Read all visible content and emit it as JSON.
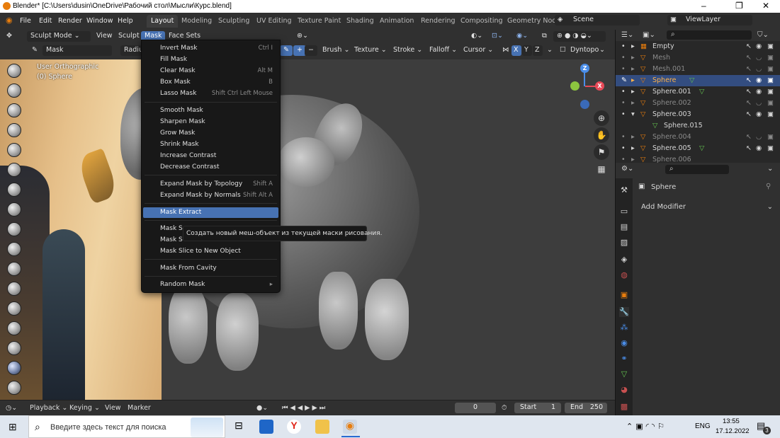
{
  "window": {
    "title": "Blender* [C:\\Users\\dusin\\OneDrive\\Рабочий стол\\Мысли\\Курс.blend]",
    "controls": [
      "–",
      "❐",
      "✕"
    ]
  },
  "menubar": {
    "items": [
      "File",
      "Edit",
      "Render",
      "Window",
      "Help"
    ],
    "workspaces": [
      "Layout",
      "Modeling",
      "Sculpting",
      "UV Editing",
      "Texture Paint",
      "Shading",
      "Animation",
      "Rendering",
      "Compositing",
      "Geometry Noc"
    ],
    "active_workspace": "Layout",
    "scene_label": "Scene",
    "viewlayer_label": "ViewLayer"
  },
  "header": {
    "mode": "Sculpt Mode",
    "menus": [
      "View",
      "Sculpt",
      "Mask",
      "Face Sets"
    ],
    "tool_name": "Mask",
    "radius_label": "Radiu",
    "plus": "+",
    "minus": "−",
    "dropdowns": [
      "Brush",
      "Texture",
      "Stroke",
      "Falloff",
      "Cursor"
    ],
    "axes": [
      "X",
      "Y",
      "Z"
    ],
    "dyntopo": "Dyntopo"
  },
  "viewport": {
    "view_name": "User Orthographic",
    "object_name": "(0) Sphere",
    "gizmo": {
      "z": "Z",
      "x": "X",
      "y": "Y"
    }
  },
  "mask_menu": {
    "groups": [
      [
        {
          "label": "Invert Mask",
          "shortcut": "Ctrl I"
        },
        {
          "label": "Fill Mask",
          "shortcut": ""
        },
        {
          "label": "Clear Mask",
          "shortcut": "Alt M"
        },
        {
          "label": "Box Mask",
          "shortcut": "B"
        },
        {
          "label": "Lasso Mask",
          "shortcut": "Shift Ctrl Left Mouse"
        }
      ],
      [
        {
          "label": "Smooth Mask",
          "shortcut": ""
        },
        {
          "label": "Sharpen Mask",
          "shortcut": ""
        },
        {
          "label": "Grow Mask",
          "shortcut": ""
        },
        {
          "label": "Shrink Mask",
          "shortcut": ""
        },
        {
          "label": "Increase Contrast",
          "shortcut": ""
        },
        {
          "label": "Decrease Contrast",
          "shortcut": ""
        }
      ],
      [
        {
          "label": "Expand Mask by Topology",
          "shortcut": "Shift A"
        },
        {
          "label": "Expand Mask by Normals",
          "shortcut": "Shift Alt A"
        }
      ],
      [
        {
          "label": "Mask Extract",
          "shortcut": "",
          "highlighted": true
        }
      ],
      [
        {
          "label": "Mask S",
          "shortcut": ""
        },
        {
          "label": "Mask S",
          "shortcut": ""
        },
        {
          "label": "Mask Slice to New Object",
          "shortcut": ""
        }
      ],
      [
        {
          "label": "Mask From Cavity",
          "shortcut": ""
        }
      ],
      [
        {
          "label": "Random Mask",
          "shortcut": "▸"
        }
      ]
    ],
    "tooltip": "Создать новый меш-объект из текущей маски рисования."
  },
  "timeline": {
    "playback": "Playback",
    "keying": "Keying",
    "view": "View",
    "marker": "Marker",
    "current_frame": "0",
    "start_label": "Start",
    "start": "1",
    "end_label": "End",
    "end": "250"
  },
  "outliner": {
    "rows": [
      {
        "name": "Empty",
        "dim": false,
        "selected": false,
        "child": false
      },
      {
        "name": "Mesh",
        "dim": true,
        "selected": false,
        "child": false
      },
      {
        "name": "Mesh.001",
        "dim": true,
        "selected": false,
        "child": false
      },
      {
        "name": "Sphere",
        "dim": false,
        "selected": true,
        "child": false
      },
      {
        "name": "Sphere.001",
        "dim": false,
        "selected": false,
        "child": false
      },
      {
        "name": "Sphere.002",
        "dim": true,
        "selected": false,
        "child": false
      },
      {
        "name": "Sphere.003",
        "dim": false,
        "selected": false,
        "child": false
      },
      {
        "name": "Sphere.015",
        "dim": false,
        "selected": false,
        "child": true
      },
      {
        "name": "Sphere.004",
        "dim": true,
        "selected": false,
        "child": false
      },
      {
        "name": "Sphere.005",
        "dim": false,
        "selected": false,
        "child": false
      },
      {
        "name": "Sphere.006",
        "dim": true,
        "selected": false,
        "child": false
      }
    ]
  },
  "properties": {
    "object_name": "Sphere",
    "add_modifier": "Add Modifier"
  },
  "taskbar": {
    "search_placeholder": "Введите здесь текст для поиска",
    "lang": "ENG",
    "time": "13:55",
    "date": "17.12.2022",
    "notif_count": "3"
  },
  "colors": {
    "accent": "#4772b3",
    "selected_row": "#334d80",
    "object_orange": "#e87d0d",
    "mesh_green": "#63c34f"
  }
}
